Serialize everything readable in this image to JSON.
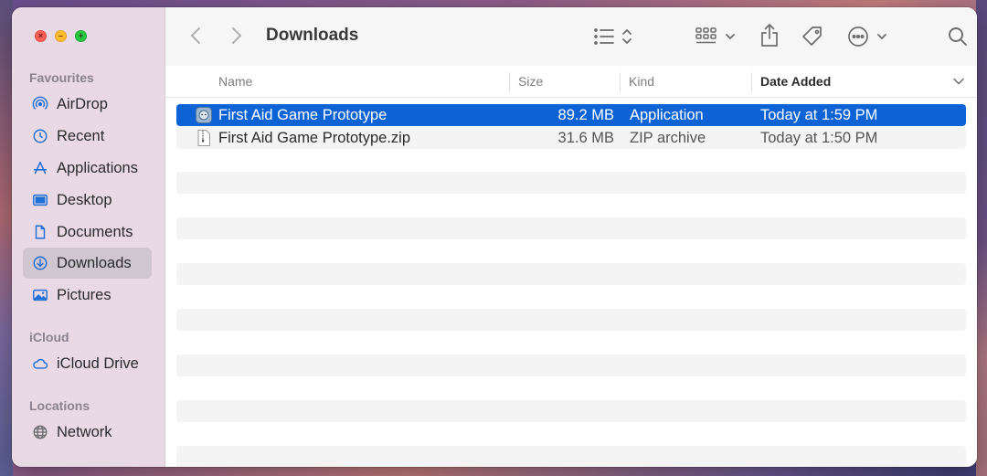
{
  "window": {
    "title": "Downloads"
  },
  "traffic_lights": {
    "close": "×",
    "minimize": "–",
    "zoom": "+"
  },
  "sidebar": {
    "sections": [
      {
        "title": "Favourites",
        "items": [
          {
            "label": "AirDrop",
            "icon": "airdrop-icon"
          },
          {
            "label": "Recent",
            "icon": "clock-icon"
          },
          {
            "label": "Applications",
            "icon": "applications-icon"
          },
          {
            "label": "Desktop",
            "icon": "desktop-icon"
          },
          {
            "label": "Documents",
            "icon": "document-icon"
          },
          {
            "label": "Downloads",
            "icon": "download-icon",
            "selected": true
          },
          {
            "label": "Pictures",
            "icon": "pictures-icon"
          }
        ]
      },
      {
        "title": "iCloud",
        "items": [
          {
            "label": "iCloud Drive",
            "icon": "cloud-icon"
          }
        ]
      },
      {
        "title": "Locations",
        "items": [
          {
            "label": "Network",
            "icon": "globe-icon"
          }
        ]
      }
    ]
  },
  "columns": {
    "name": "Name",
    "size": "Size",
    "kind": "Kind",
    "date_added": "Date Added",
    "sorted_by": "Date Added",
    "sort_direction": "descending"
  },
  "files": [
    {
      "name": "First Aid Game Prototype",
      "size": "89.2 MB",
      "kind": "Application",
      "date_added": "Today at 1:59 PM",
      "icon": "app-icon",
      "selected": true
    },
    {
      "name": "First Aid Game Prototype.zip",
      "size": "31.6 MB",
      "kind": "ZIP archive",
      "date_added": "Today at 1:50 PM",
      "icon": "zip-file-icon",
      "selected": false
    }
  ],
  "colors": {
    "accent": "#0b63d6",
    "sidebar_bg": "#e8d9e5",
    "selected_sidebar": "#cfc6d0"
  }
}
